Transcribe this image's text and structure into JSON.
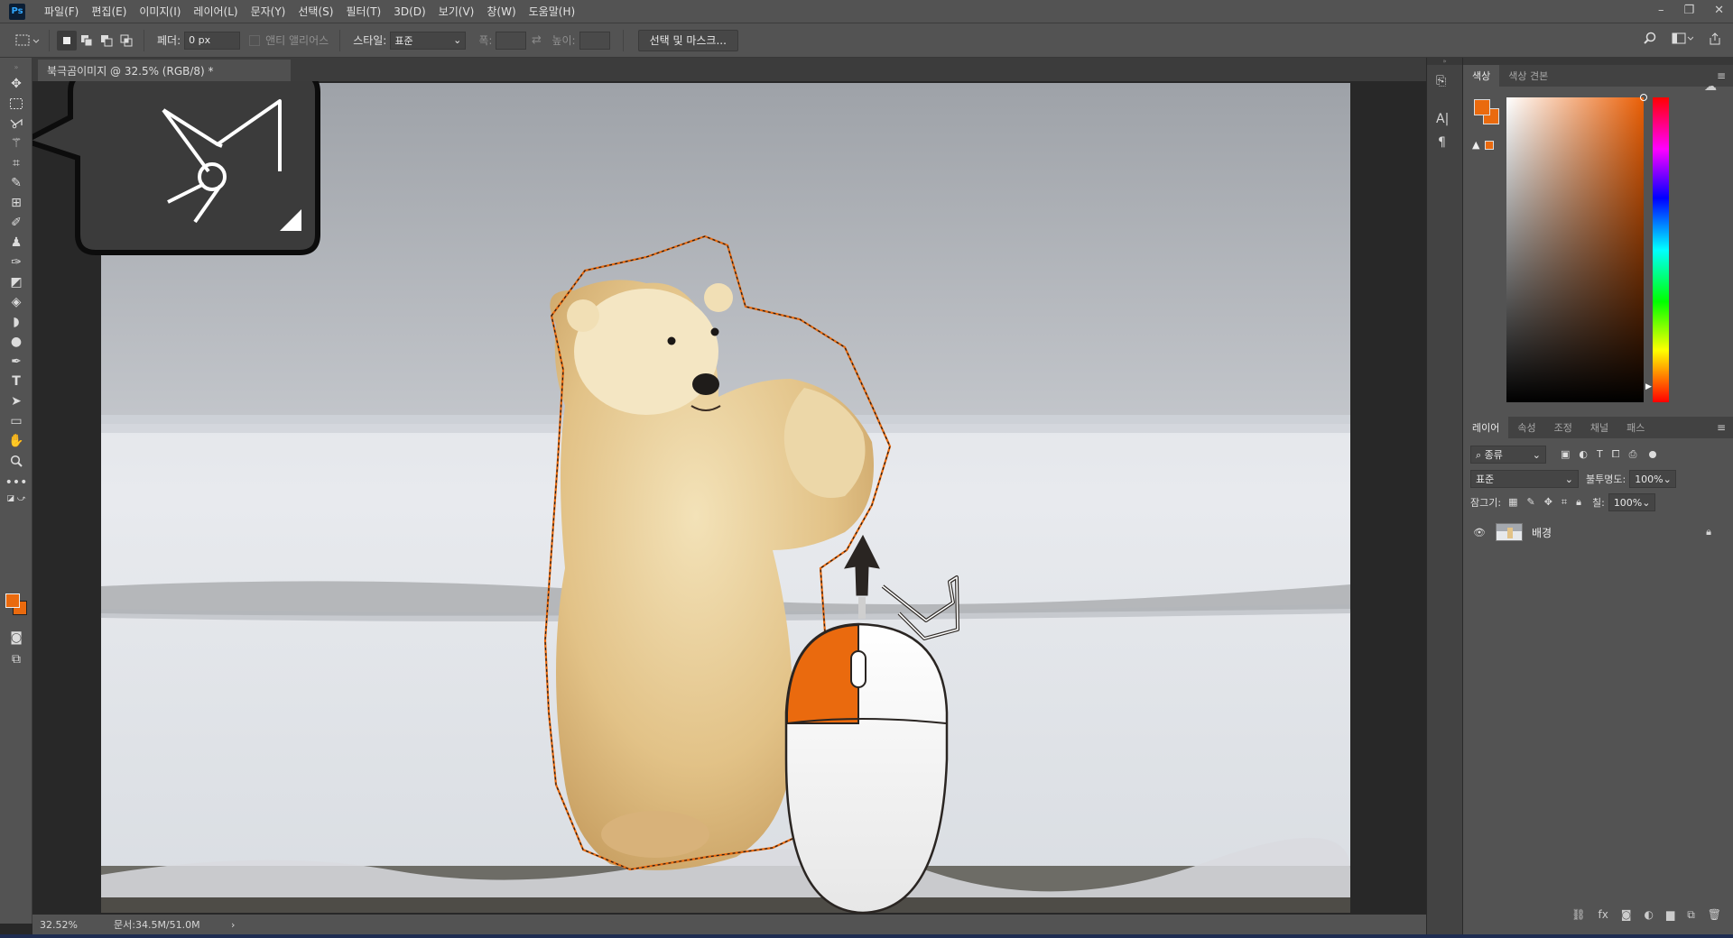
{
  "menubar": {
    "logo": "Ps",
    "items": [
      "파일(F)",
      "편집(E)",
      "이미지(I)",
      "레이어(L)",
      "문자(Y)",
      "선택(S)",
      "필터(T)",
      "3D(D)",
      "보기(V)",
      "창(W)",
      "도움말(H)"
    ],
    "window_controls": [
      "–",
      "❐",
      "✕"
    ]
  },
  "options": {
    "feather_label": "페더:",
    "feather_value": "0 px",
    "antialias_label": "앤티 앨리어스",
    "style_label": "스타일:",
    "style_value": "표준",
    "width_label": "폭:",
    "height_label": "높이:",
    "select_mask_button": "선택 및 마스크..."
  },
  "document": {
    "tab_title": "북극곰이미지 @ 32.5% (RGB/8) *",
    "zoom": "32.52%",
    "doc_size": "문서:34.5M/51.0M",
    "status_arrow": "›"
  },
  "tool_callout": {
    "icon": "polygonal-lasso-icon"
  },
  "color_panel": {
    "tabs": [
      "색상",
      "색상 견본"
    ],
    "foreground": "#f06d0f",
    "background": "#f06d0f"
  },
  "layers_panel": {
    "tabs": [
      "레이어",
      "속성",
      "조정",
      "채널",
      "패스"
    ],
    "filter_label": "종류",
    "blend_mode": "표준",
    "opacity_label": "불투명도:",
    "opacity_value": "100%",
    "lock_label": "잠그기:",
    "fill_label": "칠:",
    "fill_value": "100%",
    "layers": [
      {
        "name": "배경",
        "visible": true,
        "locked": true
      }
    ]
  },
  "colors": {
    "accent_orange": "#ea6a0e",
    "chrome_bg": "#535353",
    "canvas_bg": "#282828"
  }
}
